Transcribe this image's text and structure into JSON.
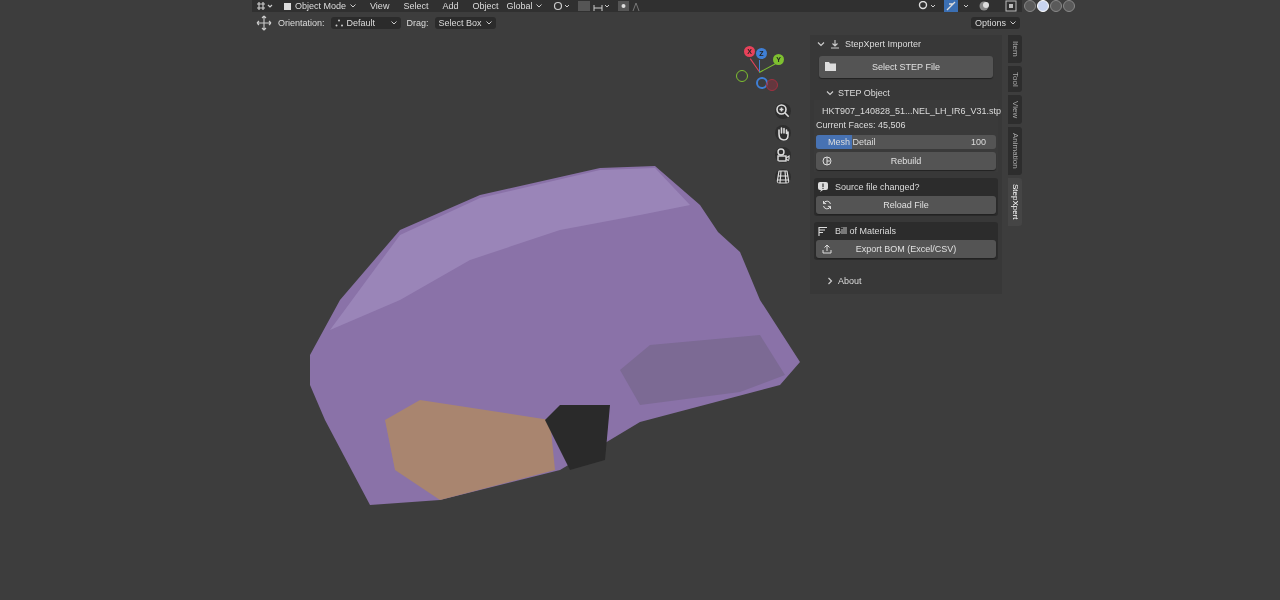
{
  "header": {
    "mode": "Object Mode",
    "menus": [
      "View",
      "Select",
      "Add",
      "Object"
    ],
    "transform_orientation": "Global",
    "shading_modes": [
      {
        "selected": false
      },
      {
        "selected": true
      },
      {
        "selected": false
      },
      {
        "selected": false
      }
    ]
  },
  "tool_settings": {
    "orientation_label": "Orientation:",
    "orientation_value": "Default",
    "drag_label": "Drag:",
    "drag_value": "Select Box",
    "options": "Options"
  },
  "gizmo": {
    "axes": [
      {
        "label": "X",
        "color": "#e8425a"
      },
      {
        "label": "Z",
        "color": "#3f7fd6"
      },
      {
        "label": "Y",
        "color": "#7ec030"
      }
    ]
  },
  "side_tabs": [
    {
      "label": "Item",
      "selected": false
    },
    {
      "label": "Tool",
      "selected": false
    },
    {
      "label": "View",
      "selected": false
    },
    {
      "label": "Animation",
      "selected": false
    },
    {
      "label": "StepXpert",
      "selected": true
    }
  ],
  "panel": {
    "title": "StepXpert Importer",
    "expanded": true,
    "select_button": "Select STEP File",
    "step_object": {
      "title": "STEP Object",
      "expanded": true,
      "filename": "HKT907_140828_51...NEL_LH_IR6_V31.stp",
      "faces": "Current Faces: 45,506",
      "slider": {
        "label": "Mesh Detail",
        "value": "100",
        "level": 0.2
      },
      "rebuild": "Rebuild"
    },
    "source_box": {
      "title": "Source file changed?",
      "button": "Reload File"
    },
    "bom_box": {
      "title": "Bill of Materials",
      "button": "Export BOM (Excel/CSV)"
    },
    "about": {
      "title": "About",
      "expanded": false
    }
  }
}
